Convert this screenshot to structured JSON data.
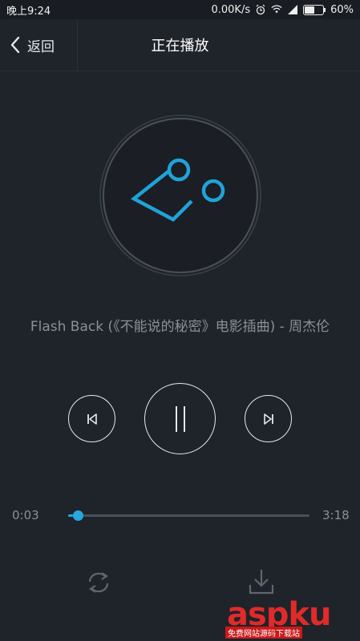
{
  "statusbar": {
    "time": "晚上9:24",
    "net_speed": "0.00K/s",
    "battery": "60%",
    "battery_level": 0.6
  },
  "header": {
    "back_label": "返回",
    "title": "正在播放"
  },
  "song": {
    "title": "Flash Back (《不能说的秘密》电影插曲) - 周杰伦"
  },
  "player": {
    "elapsed": "0:03",
    "duration": "3:18",
    "progress": 0.02
  },
  "colors": {
    "accent": "#25a8e0",
    "background": "#1f232a"
  },
  "icons": {
    "back": "chevron-left-icon",
    "prev": "skip-previous-icon",
    "pause": "pause-icon",
    "next": "skip-next-icon",
    "repeat": "repeat-icon",
    "download": "download-icon"
  },
  "watermark": {
    "brand": "aspku",
    "sub": "免费网站源码下载站"
  }
}
